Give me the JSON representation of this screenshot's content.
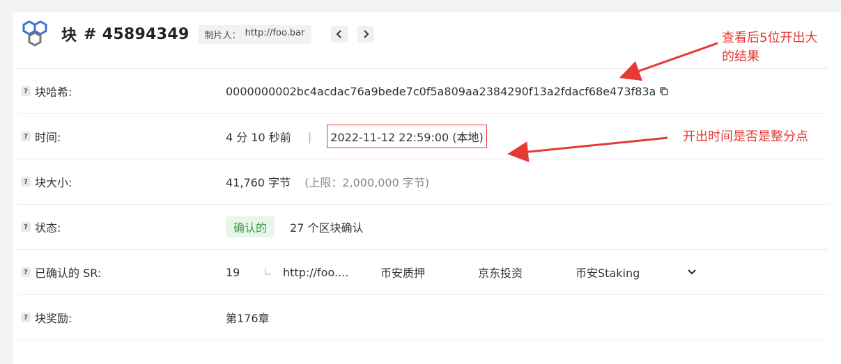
{
  "header": {
    "block_label": "块",
    "block_number": "# 45894349",
    "producer_label": "制片人：",
    "producer_value": "http://foo.bar",
    "prev_icon": "chevron-left-icon",
    "next_icon": "chevron-right-icon"
  },
  "rows": {
    "hash": {
      "label": "块哈希:",
      "value": "0000000002bc4acdac76a9bede7c0f5a809aa2384290f13a2fdacf68e473f83a"
    },
    "time": {
      "label": "时间:",
      "relative": "4 分 10 秒前",
      "separator": "|",
      "absolute": "2022-11-12 22:59:00 (本地)"
    },
    "size": {
      "label": "块大小:",
      "value": "41,760 字节",
      "limit": "(上限：2,000,000 字节)"
    },
    "status": {
      "label": "状态:",
      "badge": "确认的",
      "confirmations": "27 个区块确认"
    },
    "sr": {
      "label": "已确认的 SR:",
      "count": "19",
      "items": [
        "http://foo....",
        "币安质押",
        "京东投资",
        "币安Staking"
      ]
    },
    "reward": {
      "label": "块奖励:",
      "value": "第176章"
    }
  },
  "annotations": {
    "top": "查看后5位开出大\n的结果",
    "middle": "开出时间是否是整分点"
  },
  "colors": {
    "annotation": "#e53935",
    "badge_bg": "#e8f5e9",
    "badge_text": "#3a9d4a",
    "logo": "#3b6fd6"
  }
}
